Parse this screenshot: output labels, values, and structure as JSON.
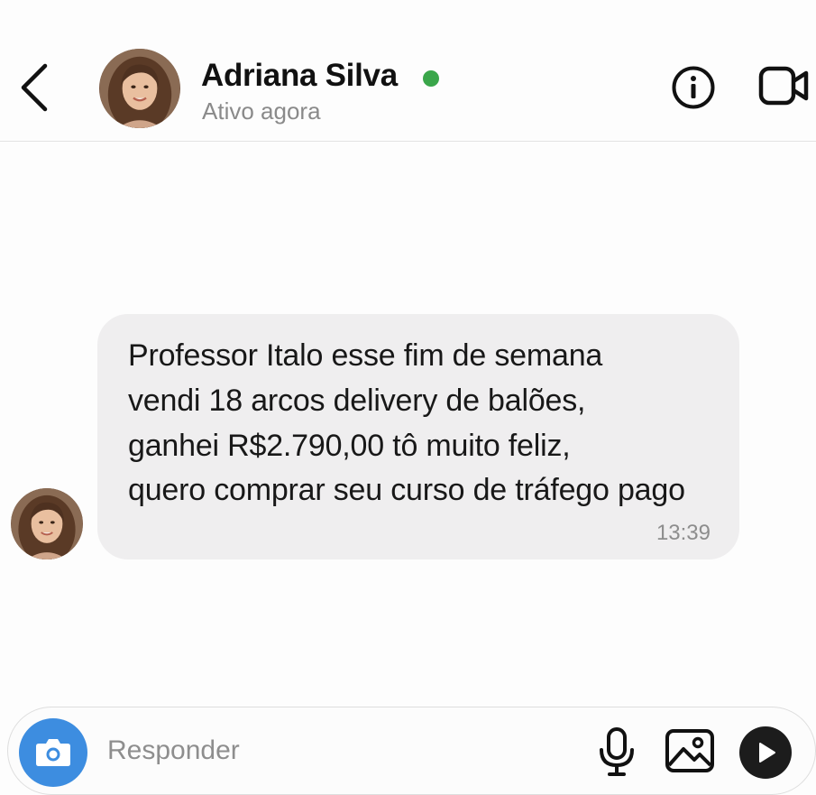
{
  "header": {
    "contact_name": "Adriana Silva",
    "status": "Ativo agora",
    "online_color": "#3aa64a",
    "icons": {
      "back": "chevron-left-icon",
      "info": "info-icon",
      "video": "video-camera-icon"
    }
  },
  "conversation": {
    "messages": [
      {
        "direction": "incoming",
        "lines": [
          "Professor Italo esse fim de semana",
          "vendi 18 arcos delivery de balões,",
          "ganhei R$2.790,00 tô muito feliz,",
          "quero comprar seu curso de tráfego pago"
        ],
        "time": "13:39"
      }
    ]
  },
  "composer": {
    "placeholder": "Responder",
    "value": "",
    "camera_color": "#3d8de0",
    "icons": {
      "camera": "camera-icon",
      "mic": "microphone-icon",
      "image": "image-icon",
      "send": "play-send-icon"
    }
  }
}
